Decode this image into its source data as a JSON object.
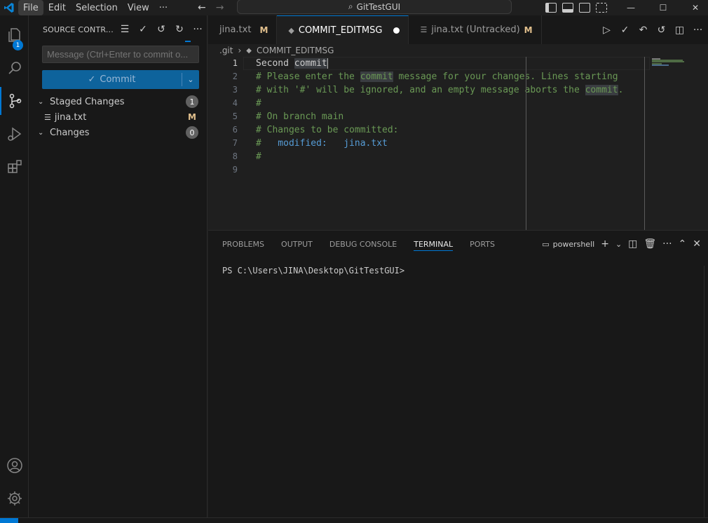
{
  "titlebar": {
    "menu": [
      "File",
      "Edit",
      "Selection",
      "View"
    ],
    "more": "···",
    "search_text": "GitTestGUI"
  },
  "activity": {
    "explorer_badge": "1"
  },
  "sidebar": {
    "title": "SOURCE CONTR...",
    "message_placeholder": "Message (Ctrl+Enter to commit o...",
    "commit_label": "Commit",
    "staged": {
      "label": "Staged Changes",
      "count": "1"
    },
    "staged_file": {
      "name": "jina.txt",
      "status": "M"
    },
    "changes": {
      "label": "Changes",
      "count": "0"
    }
  },
  "tabs": [
    {
      "label": "jina.txt",
      "status": "M"
    },
    {
      "label": "COMMIT_EDITMSG"
    },
    {
      "label": "jina.txt (Untracked)",
      "status": "M"
    }
  ],
  "breadcrumb": {
    "folder": ".git",
    "file": "COMMIT_EDITMSG"
  },
  "editor": {
    "line_numbers": [
      "1",
      "2",
      "3",
      "4",
      "5",
      "6",
      "7",
      "8",
      "9"
    ],
    "line1_a": "Second ",
    "line1_b": "commit",
    "line2_a": "# Please enter the ",
    "line2_b": "commit",
    "line2_c": " message for your changes. Lines starting",
    "line3_a": "# with '#' will be ignored, and an empty message aborts the ",
    "line3_b": "commit",
    "line3_c": ".",
    "line4": "#",
    "line5": "# On branch main",
    "line6": "# Changes to be committed:",
    "line7_a": "#",
    "line7_b": "   modified:   jina.txt",
    "line8": "#"
  },
  "panel": {
    "tabs": [
      "PROBLEMS",
      "OUTPUT",
      "DEBUG CONSOLE",
      "TERMINAL",
      "PORTS"
    ],
    "shell": "powershell",
    "prompt": "PS C:\\Users\\JINA\\Desktop\\GitTestGUI>"
  },
  "colors": {
    "accent": "#0078d4",
    "commit_button": "#0e639c",
    "modified": "#e2c08d",
    "comment": "#6a9955",
    "keyword": "#569cd6"
  }
}
